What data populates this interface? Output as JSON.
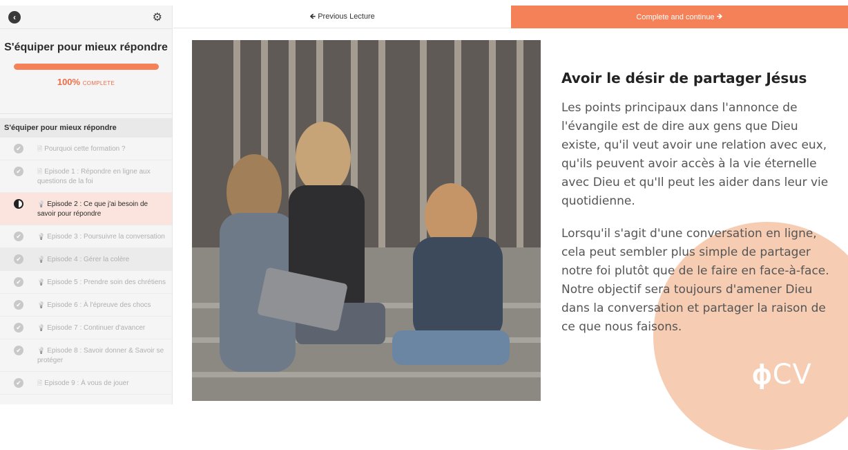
{
  "sidebar": {
    "course_title": "S'équiper pour mieux répondre",
    "progress_pct": "100%",
    "progress_label": "COMPLETE",
    "progress_value": 1.0,
    "section_title": "S'équiper pour mieux répondre",
    "lectures": [
      {
        "label": "Pourquoi cette formation ?",
        "type": "doc-icon",
        "state": "complete"
      },
      {
        "label": "Episode 1 : Répondre en ligne aux questions de la foi",
        "type": "doc-icon",
        "state": "complete"
      },
      {
        "label": "Episode 2 : Ce que j'ai besoin de savoir pour répondre",
        "type": "lightbulb-icon",
        "state": "current"
      },
      {
        "label": "Episode 3 : Poursuivre la conversation",
        "type": "lightbulb-icon",
        "state": "complete"
      },
      {
        "label": "Episode 4 : Gérer la colère",
        "type": "lightbulb-icon",
        "state": "complete"
      },
      {
        "label": "Episode 5 : Prendre soin des chrétiens",
        "type": "lightbulb-icon",
        "state": "complete"
      },
      {
        "label": "Episode 6 : À l'épreuve des chocs",
        "type": "lightbulb-icon",
        "state": "complete"
      },
      {
        "label": "Episode 7 : Continuer d'avancer",
        "type": "lightbulb-icon",
        "state": "complete"
      },
      {
        "label": "Episode 8 : Savoir donner & Savoir se protéger",
        "type": "lightbulb-icon",
        "state": "complete"
      },
      {
        "label": "Episode 9 : À vous de jouer",
        "type": "doc-icon",
        "state": "complete"
      }
    ]
  },
  "nav": {
    "previous_label": "Previous Lecture",
    "next_label": "Complete and continue"
  },
  "content": {
    "heading": "Avoir le désir de partager Jésus",
    "paragraph1": "Les points principaux dans l'annonce de l'évangile est de dire aux gens que Dieu existe, qu'il veut avoir une relation avec eux, qu'ils peuvent avoir accès à la vie éternelle avec Dieu et qu'Il peut les aider dans leur vie quotidienne.",
    "paragraph2": "Lorsqu'il s'agit d'une conversation en ligne, cela peut sembler plus simple de partager notre foi plutôt que de le faire en face-à-face. Notre objectif sera toujours d'amener Dieu dans la conversation et partager la raison de ce que nous faisons.",
    "logo_text": "CV"
  },
  "colors": {
    "accent": "#f48158",
    "blob": "#f6c9ae"
  }
}
